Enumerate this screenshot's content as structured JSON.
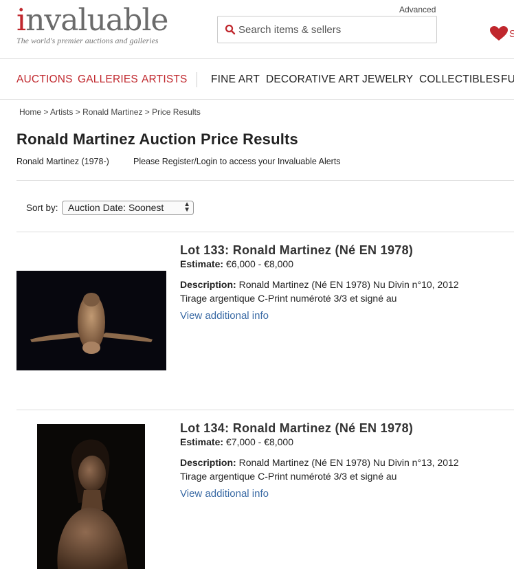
{
  "header": {
    "logo_first": "i",
    "logo_rest": "nvaluable",
    "logo_tagline": "The world's premier auctions and galleries",
    "advanced_label": "Advanced",
    "search_placeholder": "Search items & sellers",
    "heart_text": "S"
  },
  "nav": {
    "red_items": [
      "AUCTIONS",
      "GALLERIES",
      "ARTISTS"
    ],
    "items": [
      "FINE ART",
      "DECORATIVE ART",
      "JEWELRY",
      "COLLECTIBLES",
      "FU"
    ]
  },
  "breadcrumb": [
    "Home",
    "Artists",
    "Ronald Martinez",
    "Price Results"
  ],
  "breadcrumb_sep": " > ",
  "page": {
    "title": "Ronald Martinez Auction Price Results",
    "artist_dates": "Ronald Martinez (1978-)",
    "register_text": "Please Register/Login to access your Invaluable Alerts"
  },
  "sort": {
    "label": "Sort by:",
    "selected": "Auction Date: Soonest"
  },
  "lots": [
    {
      "title": "Lot 133: Ronald Martinez (Né EN 1978)",
      "estimate_label": "Estimate:",
      "estimate": "€6,000 - €8,000",
      "description_label": "Description:",
      "description": "Ronald Martinez (Né EN 1978) Nu Divin n°10, 2012 Tirage argentique C-Print numéroté 3/3 et signé au",
      "link": "View additional info"
    },
    {
      "title": "Lot 134: Ronald Martinez (Né EN 1978)",
      "estimate_label": "Estimate:",
      "estimate": "€7,000 - €8,000",
      "description_label": "Description:",
      "description": "Ronald Martinez (Né EN 1978) Nu Divin n°13, 2012 Tirage argentique C-Print numéroté 3/3 et signé au",
      "link": "View additional info"
    }
  ],
  "colors": {
    "brand_red": "#c0272d",
    "link_blue": "#3b6ba5"
  }
}
